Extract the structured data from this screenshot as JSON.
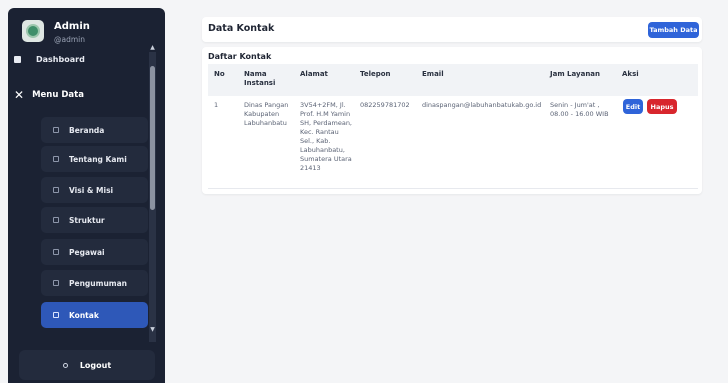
{
  "brand": {
    "name": "Admin",
    "user": "@admin"
  },
  "sidebar": {
    "dashboard": "Dashboard",
    "group": "Menu Data",
    "items": [
      {
        "label": "Beranda"
      },
      {
        "label": "Tentang Kami"
      },
      {
        "label": "Visi & Misi"
      },
      {
        "label": "Struktur"
      },
      {
        "label": "Pegawai"
      },
      {
        "label": "Pengumuman"
      },
      {
        "label": "Kontak"
      }
    ],
    "active": "Kontak",
    "logout": "Logout"
  },
  "page": {
    "title": "Data Kontak",
    "add_button": "Tambah Data"
  },
  "table": {
    "title": "Daftar Kontak",
    "columns": [
      "No",
      "Nama Instansi",
      "Alamat",
      "Telepon",
      "Email",
      "Jam Layanan",
      "Aksi"
    ],
    "rows": [
      {
        "no": "1",
        "nama": "Dinas Pangan Kabupaten Labuhanbatu",
        "alamat": "3V54+2FM, Jl. Prof. H.M Yamin SH, Perdamean, Kec. Rantau Sel., Kab. Labuhanbatu, Sumatera Utara 21413",
        "telepon": "082259781702",
        "email": "dinaspangan@labuhanbatukab.go.id",
        "jam": "Senin - Jum'at , 08.00 - 16.00 WIB",
        "edit_label": "Edit",
        "delete_label": "Hapus"
      }
    ]
  },
  "colors": {
    "sidebar_bg": "#1b2233",
    "accent": "#2f64d9",
    "danger": "#d8262d"
  }
}
